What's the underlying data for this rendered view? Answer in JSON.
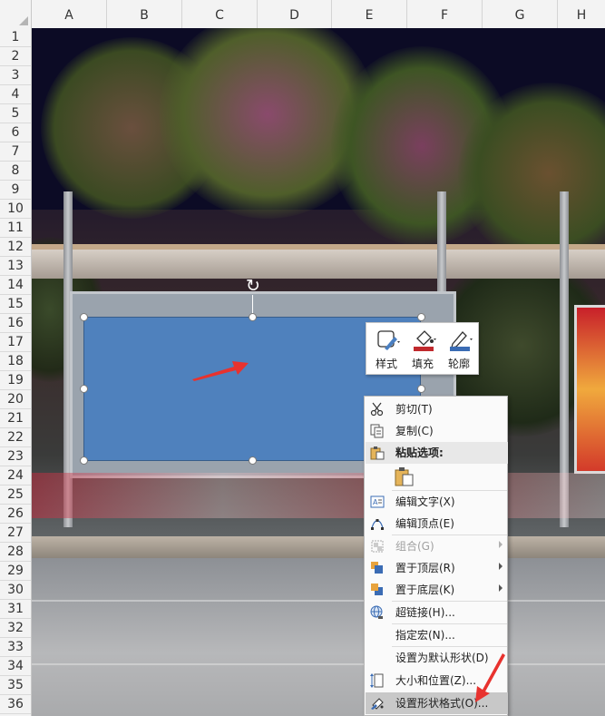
{
  "columns": [
    "A",
    "B",
    "C",
    "D",
    "E",
    "F",
    "G",
    "H"
  ],
  "rows": [
    "1",
    "2",
    "3",
    "4",
    "5",
    "6",
    "7",
    "8",
    "9",
    "10",
    "11",
    "12",
    "13",
    "14",
    "15",
    "16",
    "17",
    "18",
    "19",
    "20",
    "21",
    "22",
    "23",
    "24",
    "25",
    "26",
    "27",
    "28",
    "29",
    "30",
    "31",
    "32",
    "33",
    "34",
    "35",
    "36"
  ],
  "mini_toolbar": {
    "style_label": "样式",
    "fill_label": "填充",
    "outline_label": "轮廓"
  },
  "context_menu": {
    "cut": "剪切(T)",
    "copy": "复制(C)",
    "paste_options": "粘贴选项:",
    "edit_text": "编辑文字(X)",
    "edit_points": "编辑顶点(E)",
    "group": "组合(G)",
    "bring_to_front": "置于顶层(R)",
    "send_to_back": "置于底层(K)",
    "hyperlink": "超链接(H)...",
    "assign_macro": "指定宏(N)...",
    "set_default_shape": "设置为默认形状(D)",
    "size_position": "大小和位置(Z)...",
    "format_shape": "设置形状格式(O)..."
  },
  "colors": {
    "shape_fill": "#4f81bd",
    "arrow_red": "#e8322e",
    "fill_swatch": "#c0292d",
    "outline_swatch": "#3b6cb4"
  }
}
